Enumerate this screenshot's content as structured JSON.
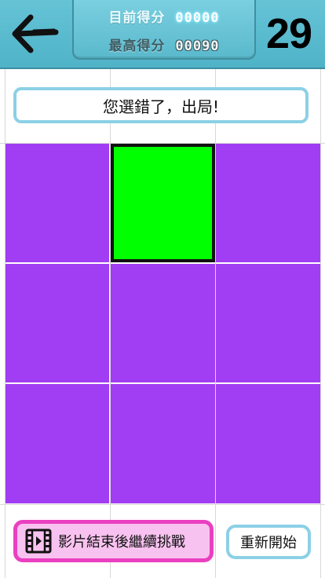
{
  "header": {
    "current_score_label": "目前得分",
    "current_score_value": "00000",
    "best_score_label": "最高得分",
    "best_score_value": "00090",
    "timer": "29"
  },
  "message": "您選錯了，出局!",
  "grid": {
    "rows": 3,
    "cols": 3,
    "tiles": [
      {
        "state": "normal"
      },
      {
        "state": "target"
      },
      {
        "state": "normal"
      },
      {
        "state": "normal"
      },
      {
        "state": "normal"
      },
      {
        "state": "normal"
      },
      {
        "state": "normal"
      },
      {
        "state": "normal"
      },
      {
        "state": "normal"
      }
    ],
    "tile_color": "#a13df2",
    "target_color": "#00ff00"
  },
  "buttons": {
    "continue_label": "影片結束後繼續挑戰",
    "restart_label": "重新開始"
  },
  "colors": {
    "header": "#5ab9cc",
    "continue_border": "#ea40c0",
    "continue_fill": "#f8c2f0",
    "accent_border": "#8cd0e6"
  }
}
